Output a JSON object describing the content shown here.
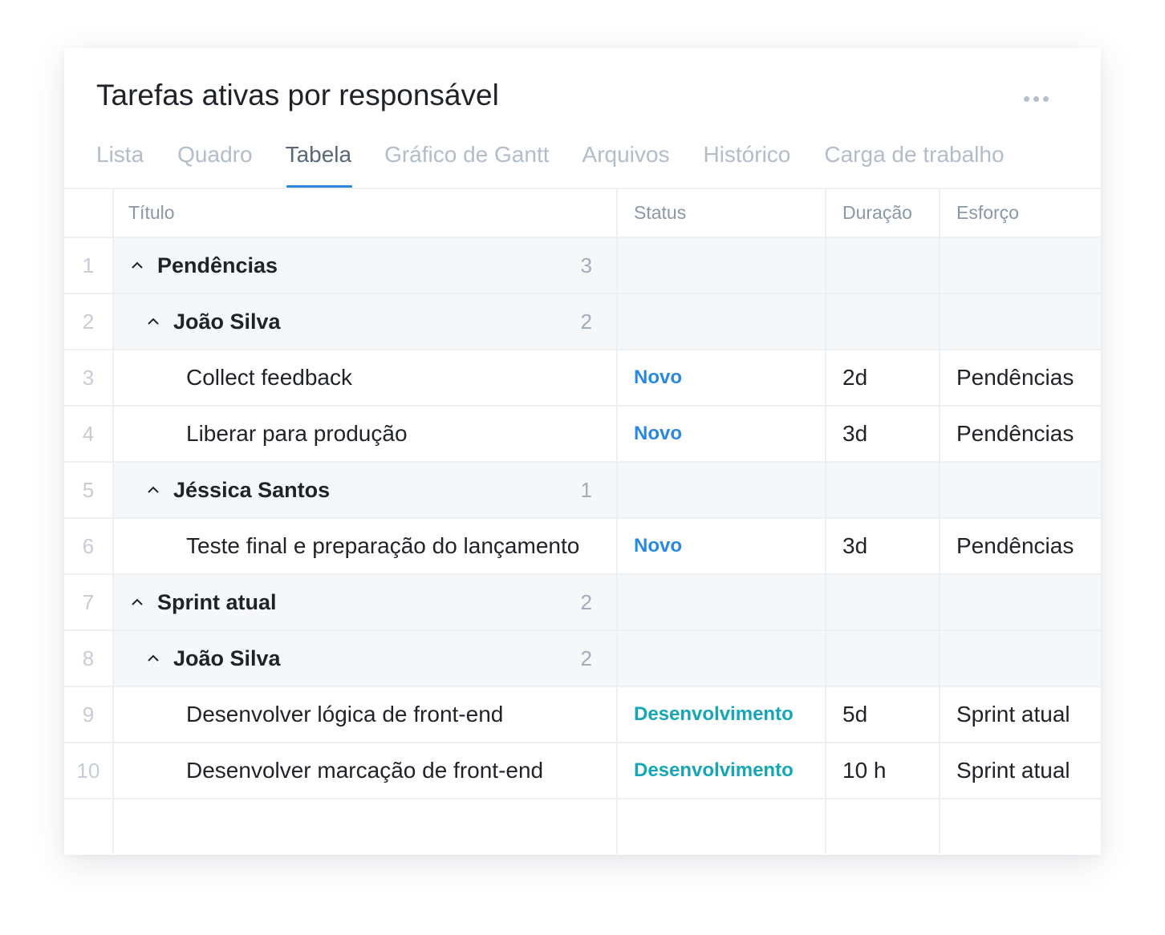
{
  "header": {
    "title": "Tarefas ativas por responsável"
  },
  "tabs": [
    {
      "label": "Lista"
    },
    {
      "label": "Quadro"
    },
    {
      "label": "Tabela",
      "active": true
    },
    {
      "label": "Gráfico de Gantt"
    },
    {
      "label": "Arquivos"
    },
    {
      "label": "Histórico"
    },
    {
      "label": "Carga de trabalho"
    }
  ],
  "table": {
    "columns": {
      "title": "Título",
      "status": "Status",
      "duration": "Duração",
      "effort": "Esforço"
    },
    "rows": [
      {
        "num": "1",
        "type": "group",
        "level": 1,
        "name": "Pendências",
        "count": "3"
      },
      {
        "num": "2",
        "type": "group",
        "level": 2,
        "name": "João Silva",
        "count": "2"
      },
      {
        "num": "3",
        "type": "task",
        "title": "Collect feedback",
        "status": "Novo",
        "duration": "2d",
        "effort": "Pendências"
      },
      {
        "num": "4",
        "type": "task",
        "title": "Liberar para produção",
        "status": "Novo",
        "duration": "3d",
        "effort": "Pendências"
      },
      {
        "num": "5",
        "type": "group",
        "level": 2,
        "name": "Jéssica Santos",
        "count": "1"
      },
      {
        "num": "6",
        "type": "task",
        "title": "Teste final e preparação do lançamento",
        "status": "Novo",
        "duration": "3d",
        "effort": "Pendências"
      },
      {
        "num": "7",
        "type": "group",
        "level": 1,
        "name": "Sprint atual",
        "count": "2"
      },
      {
        "num": "8",
        "type": "group",
        "level": 2,
        "name": "João Silva",
        "count": "2"
      },
      {
        "num": "9",
        "type": "task",
        "title": "Desenvolver lógica de front-end",
        "status": "Desenvolvimento",
        "duration": "5d",
        "effort": "Sprint atual"
      },
      {
        "num": "10",
        "type": "task",
        "title": "Desenvolver marcação de front-end",
        "status": "Desenvolvimento",
        "duration": "10 h",
        "effort": "Sprint atual"
      }
    ]
  },
  "colors": {
    "accent": "#2a88e0",
    "status_novo": "#2a88e0",
    "status_desenvolvimento": "#16a6b6"
  },
  "icons": {
    "more": "more-horizontal-icon",
    "collapse": "chevron-up-icon"
  }
}
